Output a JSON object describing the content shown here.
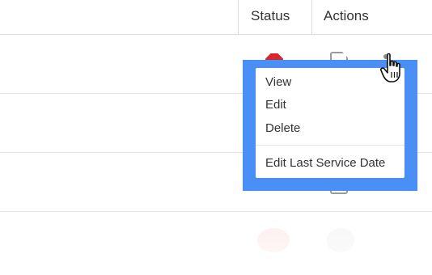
{
  "table": {
    "columns": [
      {
        "label": "Status"
      },
      {
        "label": "Actions"
      }
    ]
  },
  "menu": {
    "items": [
      {
        "label": "View"
      },
      {
        "label": "Edit"
      },
      {
        "label": "Delete"
      }
    ],
    "secondary_item": {
      "label": "Edit Last Service Date"
    }
  },
  "icons": {
    "status": "stop-sign-icon",
    "document": "document-icon",
    "more": "more-options-icon",
    "cursor": "hand-pointer-icon"
  },
  "colors": {
    "highlight": "#4a8ff5",
    "status_red": "#d9262b"
  }
}
